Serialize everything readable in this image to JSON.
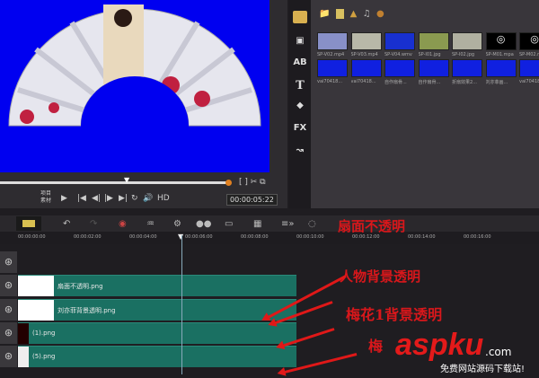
{
  "preview": {
    "mode_labels": [
      "项目",
      "素材"
    ],
    "hd": "HD",
    "timecode": "00:00:05:22",
    "progress": 0.83
  },
  "library": {
    "row1": [
      "SP-V02.mp4",
      "SP-V03.mp4",
      "SP-V04.wmv",
      "SP-I01.jpg",
      "SP-I02.jpg",
      "SP-M01.mpa",
      "SP-M02.mpa"
    ],
    "row2": [
      "vai70418...",
      "vai70418...",
      "自作扇骨...",
      "自作扇骨...",
      "折扇效果2...",
      "刘亦菲画...",
      "vai70418..."
    ],
    "side_fx": "FX"
  },
  "timeline": {
    "ruler": [
      "00:00:00:00",
      "00:00:02:00",
      "00:00:04:00",
      "00:00:06:00",
      "00:00:08:00",
      "00:00:10:00",
      "00:00:12:00",
      "00:00:14:00",
      "00:00:16:00"
    ],
    "clips": [
      "扇面不透明.png",
      "刘亦菲背景透明.png",
      "(1).png",
      "(5).png"
    ]
  },
  "annotations": [
    "扇面不透明",
    "人物背景透明",
    "梅花1背景透明",
    "梅"
  ],
  "watermark": {
    "brand": "aspku",
    ".com": ".com",
    "domain": ".com",
    "sub": "免费网站源码下载站!"
  }
}
